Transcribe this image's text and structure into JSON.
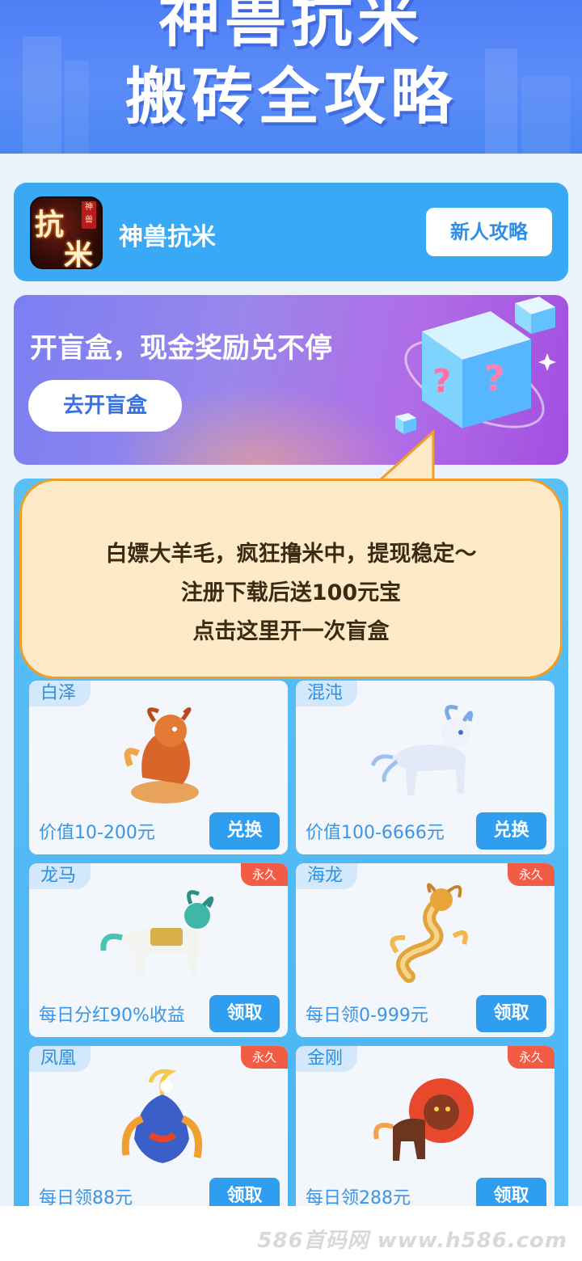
{
  "header": {
    "title_line1": "神兽抗米",
    "title_line2": "搬砖全攻略"
  },
  "app": {
    "icon_glyph_1": "抗",
    "icon_glyph_2": "米",
    "icon_seal": "神兽",
    "name": "神兽抗米",
    "guide_button": "新人攻略"
  },
  "banner": {
    "title": "开盲盒，现金奖励兑不停",
    "button": "去开盲盒"
  },
  "bubble": {
    "line1": "白嫖大羊毛，疯狂撸米中，提现稳定～",
    "line2": "注册下载后送100元宝",
    "line3": "点击这里开一次盲盒"
  },
  "cards": [
    {
      "name": "白泽",
      "badge": "",
      "value": "价值10-200元",
      "action": "兑换",
      "icon": "fire-qilin-icon"
    },
    {
      "name": "混沌",
      "badge": "",
      "value": "价值100-6666元",
      "action": "兑换",
      "icon": "ice-beast-icon"
    },
    {
      "name": "龙马",
      "badge": "永久",
      "value": "每日分红90%收益",
      "action": "领取",
      "icon": "dragon-horse-icon"
    },
    {
      "name": "海龙",
      "badge": "永久",
      "value": "每日领0-999元",
      "action": "领取",
      "icon": "sea-dragon-icon"
    },
    {
      "name": "凤凰",
      "badge": "永久",
      "value": "每日领88元",
      "action": "领取",
      "icon": "phoenix-icon"
    },
    {
      "name": "金刚",
      "badge": "永久",
      "value": "每日领288元",
      "action": "领取",
      "icon": "fire-lion-icon"
    }
  ],
  "footer": {
    "watermark": "586首码网 www.h586.com"
  },
  "colors": {
    "hero": "#4f7ff5",
    "app_card": "#3aa9f5",
    "panel": "#4ab5f5",
    "action_button": "#2f9ef0",
    "permanent_badge": "#f25c45",
    "bubble_fill": "#fdebc8",
    "bubble_border": "#f39c26"
  }
}
